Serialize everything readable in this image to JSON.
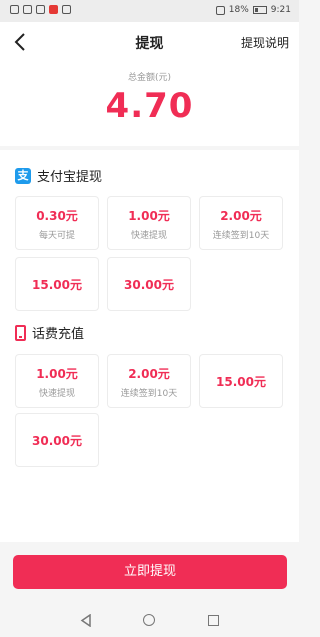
{
  "status_bar": {
    "left_icons": [
      "signal-icon",
      "wifi-icon",
      "eye-icon",
      "app-icon",
      "app-icon"
    ],
    "battery": "18%",
    "time": "9:21"
  },
  "header": {
    "back_icon": "chevron-left-icon",
    "title": "提现",
    "help_label": "提现说明"
  },
  "balance": {
    "label": "总金额(元)",
    "value": "4.70"
  },
  "alipay": {
    "title": "支付宝提现",
    "icon": "alipay-icon",
    "options": [
      {
        "amount": "0.30元",
        "note": "每天可提"
      },
      {
        "amount": "1.00元",
        "note": "快速提现"
      },
      {
        "amount": "2.00元",
        "note": "连续签到10天"
      },
      {
        "amount": "15.00元",
        "note": ""
      },
      {
        "amount": "30.00元",
        "note": ""
      }
    ]
  },
  "phone_recharge": {
    "title": "话费充值",
    "icon": "phone-icon",
    "options": [
      {
        "amount": "1.00元",
        "note": "快速提现"
      },
      {
        "amount": "2.00元",
        "note": "连续签到10天"
      },
      {
        "amount": "15.00元",
        "note": ""
      },
      {
        "amount": "30.00元",
        "note": ""
      }
    ]
  },
  "action": {
    "withdraw_label": "立即提现"
  },
  "colors": {
    "accent": "#f02d55",
    "alipay_blue": "#1e9bec"
  }
}
